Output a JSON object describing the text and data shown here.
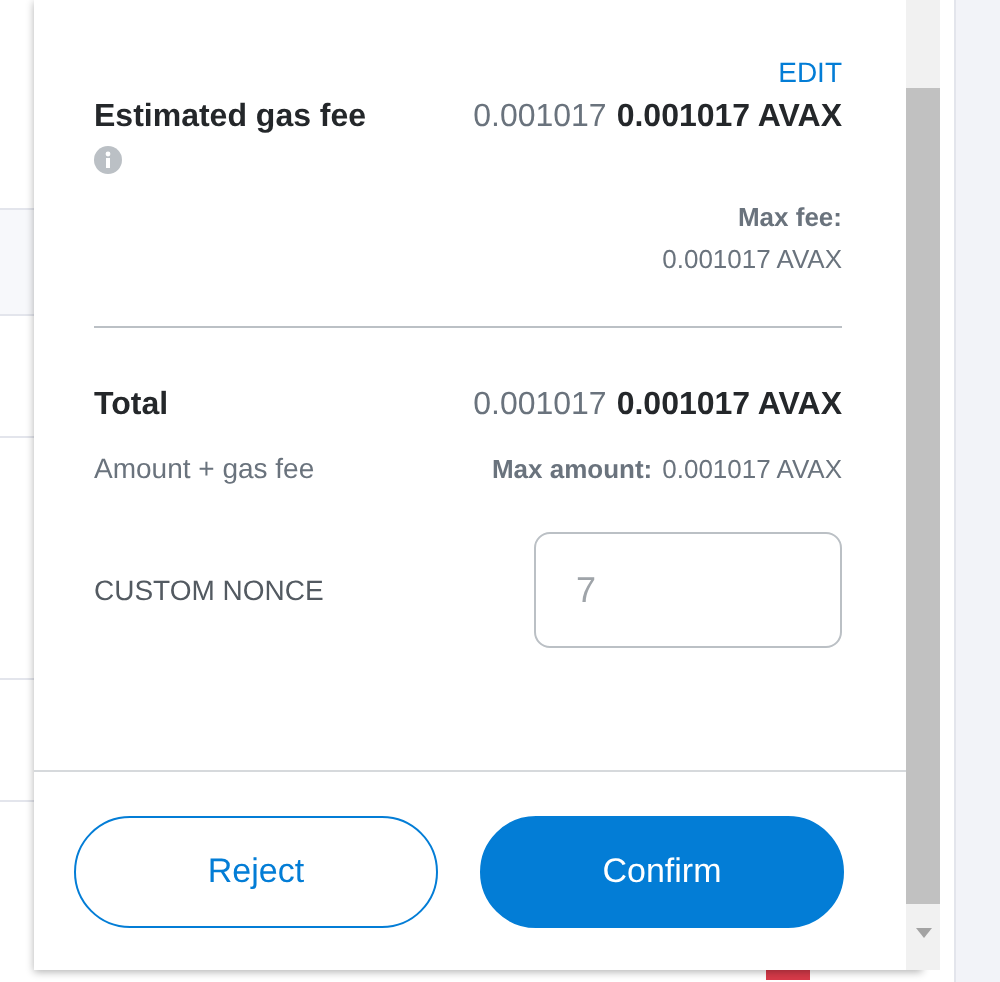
{
  "edit_link": "EDIT",
  "gas_fee": {
    "label": "Estimated gas fee",
    "secondary": "0.001017",
    "primary": "0.001017 AVAX",
    "max_label": "Max fee:",
    "max_value": "0.001017 AVAX"
  },
  "total": {
    "label": "Total",
    "secondary": "0.001017",
    "primary": "0.001017 AVAX",
    "sublabel": "Amount + gas fee",
    "max_label": "Max amount:",
    "max_value": "0.001017 AVAX"
  },
  "nonce": {
    "label": "CUSTOM NONCE",
    "placeholder": "7"
  },
  "buttons": [
    {
      "label": "Reject",
      "kind": "secondary"
    },
    {
      "label": "Confirm",
      "kind": "primary"
    }
  ]
}
